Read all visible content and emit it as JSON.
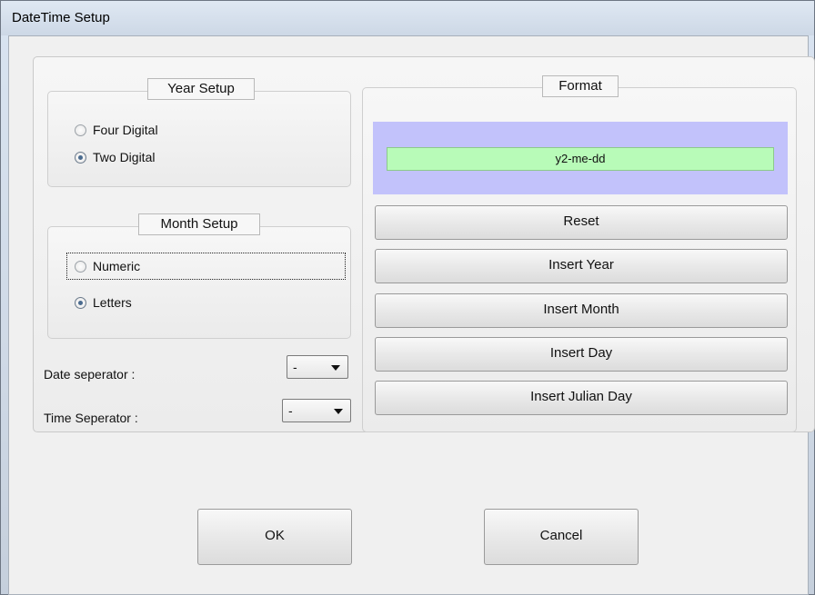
{
  "window": {
    "title": "DateTime Setup"
  },
  "year_setup": {
    "legend": "Year Setup",
    "options": [
      {
        "label": "Four Digital",
        "checked": false
      },
      {
        "label": "Two Digital",
        "checked": true
      }
    ]
  },
  "month_setup": {
    "legend": "Month Setup",
    "options": [
      {
        "label": "Numeric",
        "checked": false
      },
      {
        "label": "Letters",
        "checked": true
      }
    ]
  },
  "date_separator": {
    "label": "Date seperator :",
    "value": "-"
  },
  "time_separator": {
    "label": "Time Seperator :",
    "value": "-"
  },
  "format": {
    "legend": "Format",
    "value": "y2-me-dd",
    "preview_bg_color": "#c2c2fb",
    "field_bg_color": "#b8fbb8",
    "buttons": [
      "Reset",
      "Insert Year",
      "Insert Month",
      "Insert Day",
      "Insert Julian Day"
    ]
  },
  "footer": {
    "ok_label": "OK",
    "cancel_label": "Cancel"
  }
}
